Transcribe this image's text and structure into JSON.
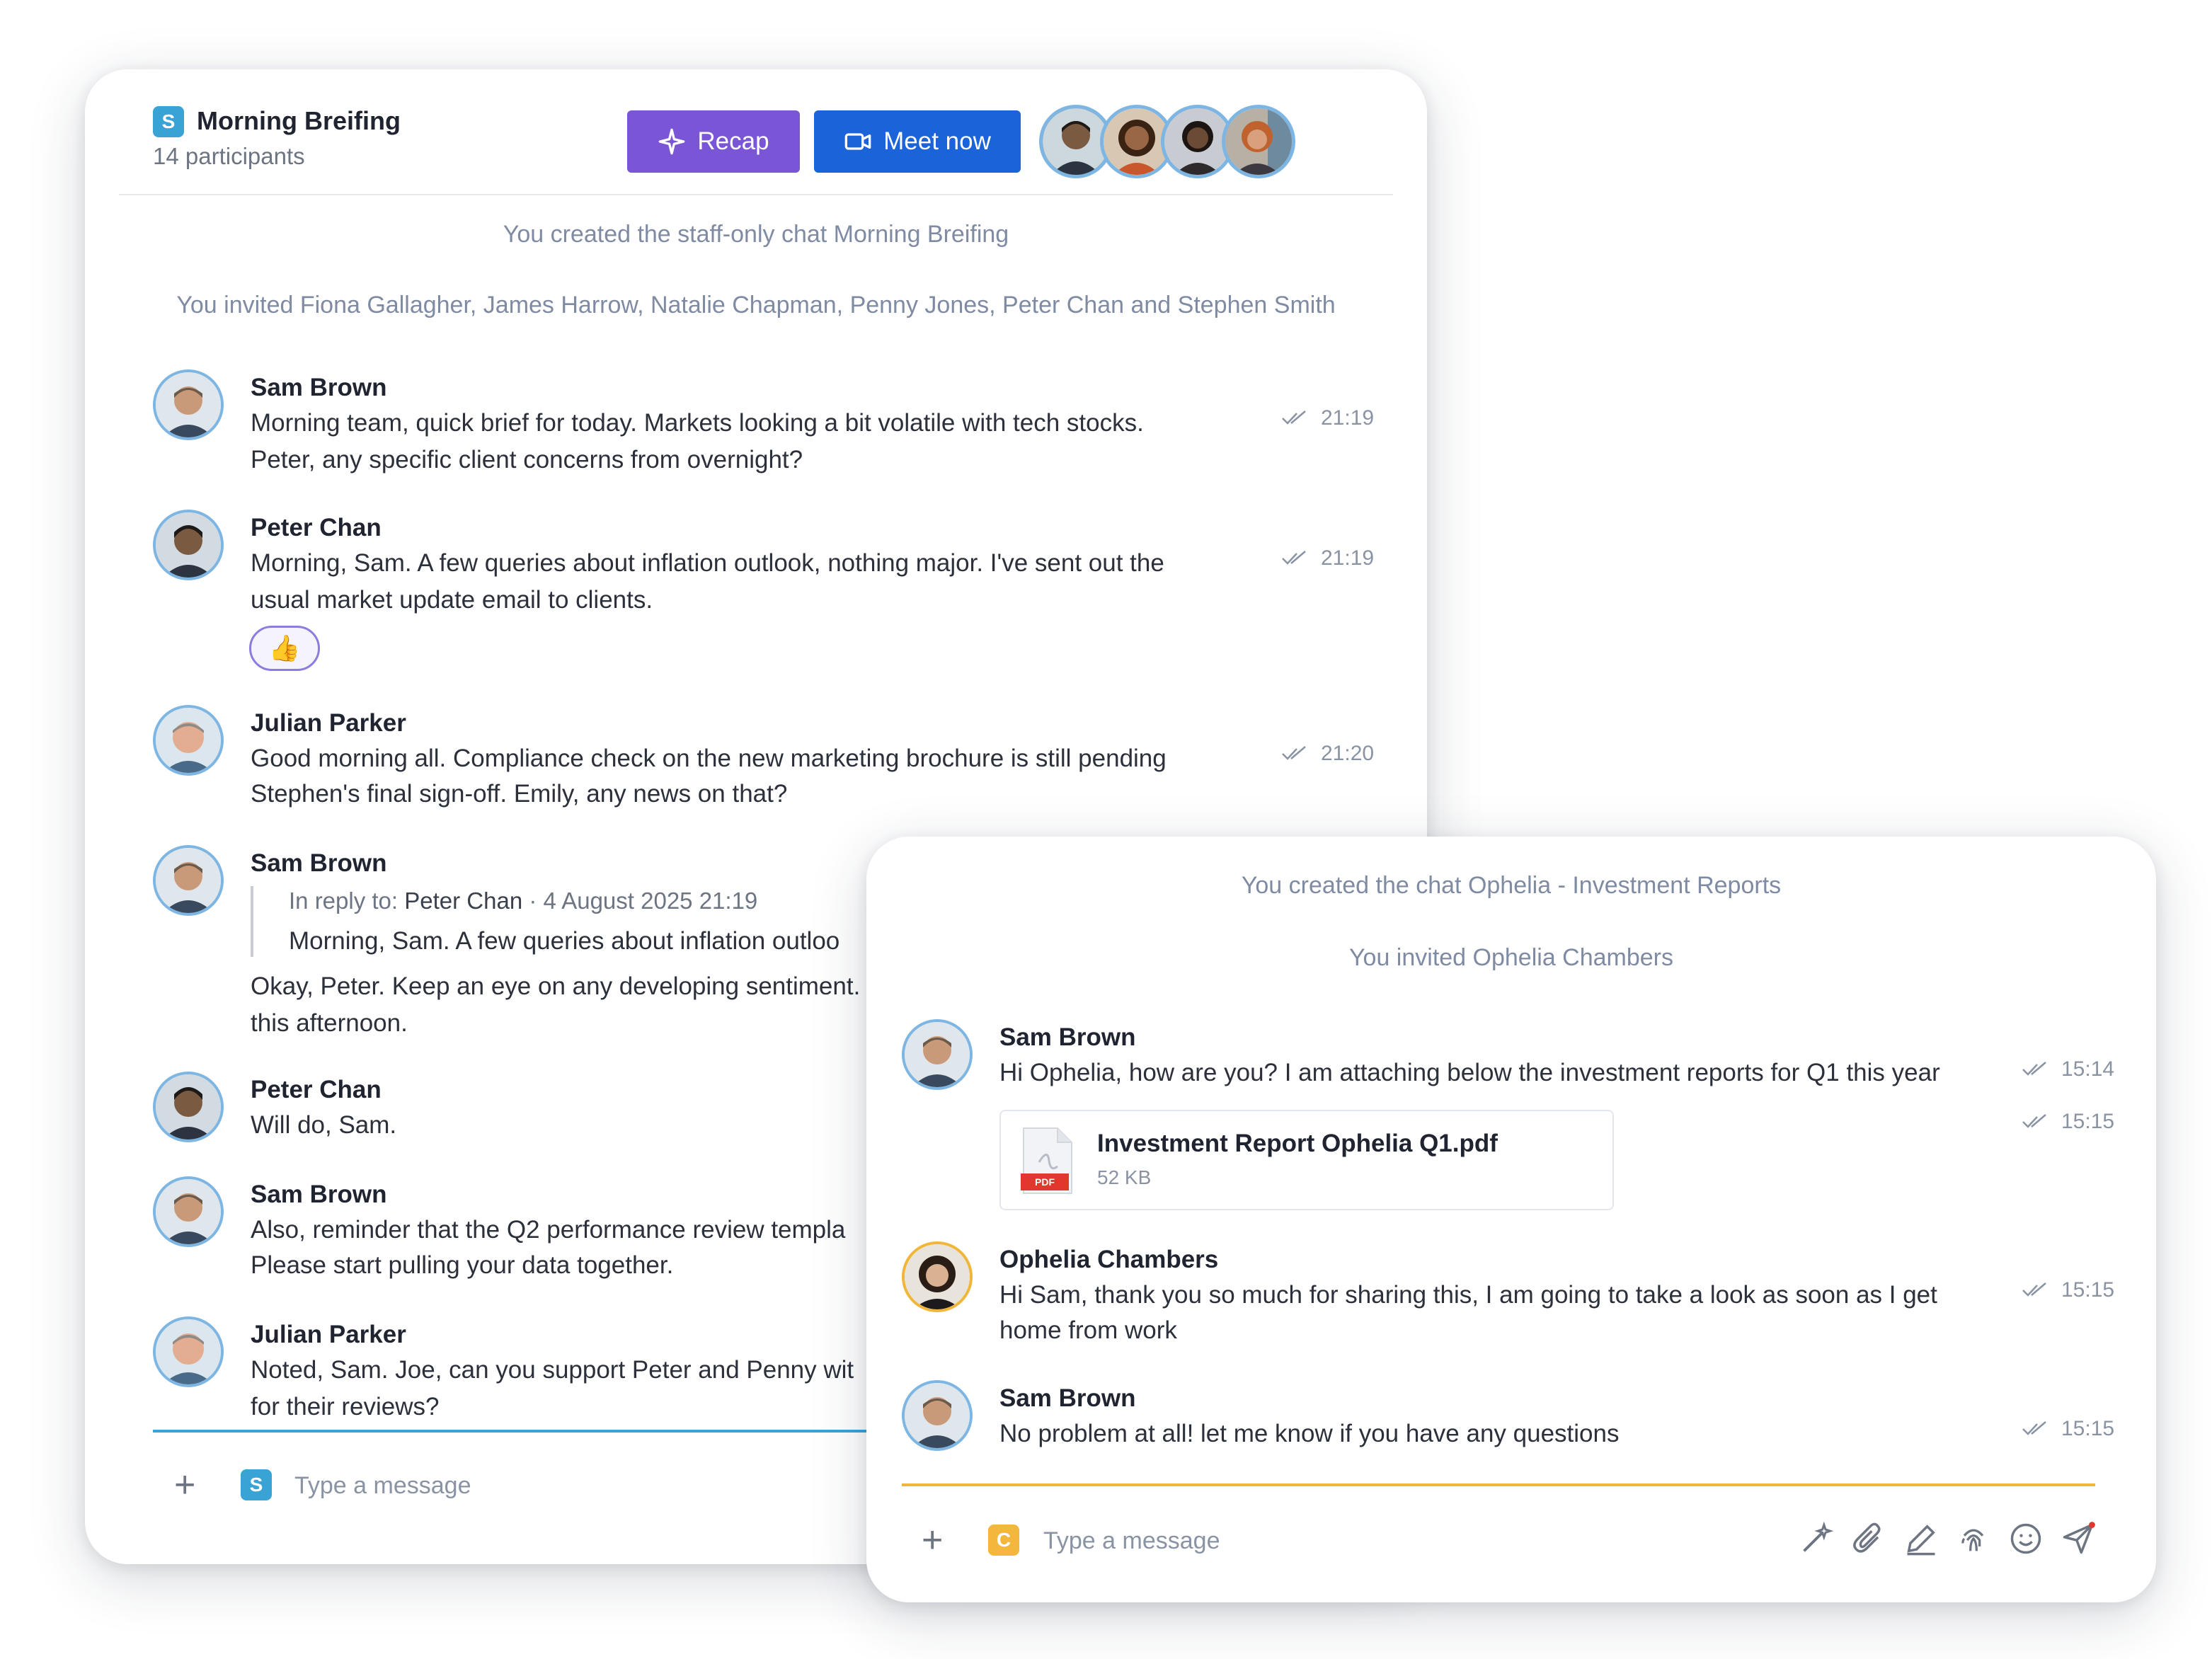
{
  "main_chat": {
    "workspace_badge": "S",
    "title": "Morning Breifing",
    "subtitle": "14 participants",
    "recap_label": "Recap",
    "meet_label": "Meet now",
    "system": [
      "You created the staff-only chat Morning Breifing",
      "You invited Fiona Gallagher, James Harrow, Natalie Chapman, Penny Jones, Peter Chan and Stephen Smith"
    ],
    "messages": [
      {
        "sender": "Sam Brown",
        "lines": [
          "Morning team, quick brief for today. Markets looking a bit volatile with tech stocks.",
          "Peter, any specific client concerns from overnight?"
        ],
        "time": "21:19"
      },
      {
        "sender": "Peter Chan",
        "lines": [
          "Morning, Sam. A few queries about inflation outlook, nothing major. I've sent out the",
          "usual market update email to clients."
        ],
        "time": "21:19",
        "reaction": "👍"
      },
      {
        "sender": "Julian Parker",
        "lines": [
          "Good morning all. Compliance check on the new marketing brochure is still pending",
          "Stephen's final sign-off. Emily, any news on that?"
        ],
        "time": "21:20"
      },
      {
        "sender": "Sam Brown",
        "reply_prefix": "In reply to:",
        "reply_to": "Peter Chan",
        "reply_date": "· 4 August 2025 21:19",
        "reply_text": "Morning, Sam. A few queries about inflation outloo",
        "lines": [
          "Okay, Peter. Keep an eye on any developing sentiment.",
          "this afternoon."
        ]
      },
      {
        "sender": "Peter Chan",
        "lines": [
          "Will do, Sam."
        ]
      },
      {
        "sender": "Sam Brown",
        "lines": [
          "Also, reminder that the Q2 performance review templa",
          "Please start pulling your data together."
        ]
      },
      {
        "sender": "Julian Parker",
        "lines": [
          "Noted, Sam. Joe, can you support Peter and Penny wit",
          "for their reviews?"
        ]
      }
    ],
    "composer": {
      "badge": "S",
      "placeholder": "Type a message"
    }
  },
  "second_chat": {
    "system": [
      "You created the chat Ophelia - Investment Reports",
      "You invited Ophelia Chambers"
    ],
    "messages": [
      {
        "sender": "Sam Brown",
        "lines": [
          "Hi Ophelia, how are you? I am attaching below the investment reports for Q1 this year"
        ],
        "time": "15:14"
      },
      {
        "file_name": "Investment Report Ophelia Q1.pdf",
        "file_size": "52 KB",
        "file_type": "PDF",
        "time": "15:15"
      },
      {
        "sender": "Ophelia Chambers",
        "lines": [
          "Hi Sam, thank you so much for sharing this, I am going to take a look as soon as I get",
          "home from work"
        ],
        "time": "15:15"
      },
      {
        "sender": "Sam Brown",
        "lines": [
          "No problem at all! let me know if you have any questions"
        ],
        "time": "15:15"
      }
    ],
    "composer": {
      "badge": "C",
      "placeholder": "Type a message"
    },
    "tools": [
      "magic-wand-icon",
      "paperclip-icon",
      "pen-icon",
      "fingerprint-icon",
      "emoji-icon",
      "send-icon"
    ]
  },
  "colors": {
    "accent_purple": "#7a55d6",
    "accent_blue": "#1a63d8",
    "composer_line_main": "#3aa3d6",
    "composer_line_second": "#f0b63a"
  }
}
